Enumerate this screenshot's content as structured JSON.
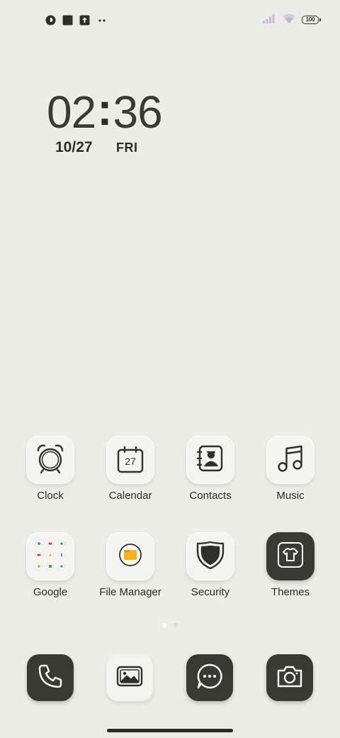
{
  "status_bar": {
    "battery_level": "100",
    "left_icons": [
      "notification-app-icon",
      "square-notification-icon",
      "upload-icon",
      "more-notifications-icon"
    ],
    "right_icons": [
      "signal-icon",
      "wifi-icon",
      "battery-icon"
    ]
  },
  "clock_widget": {
    "hours": "02",
    "separator": ":",
    "minutes": "36",
    "date": "10/27",
    "day": "FRI"
  },
  "apps": [
    {
      "label": "Clock",
      "icon": "alarm-clock-icon"
    },
    {
      "label": "Calendar",
      "icon": "calendar-icon",
      "badge": "27"
    },
    {
      "label": "Contacts",
      "icon": "contacts-book-icon"
    },
    {
      "label": "Music",
      "icon": "music-note-icon"
    },
    {
      "label": "Google",
      "icon": "google-folder-icon"
    },
    {
      "label": "File Manager",
      "icon": "folder-icon"
    },
    {
      "label": "Security",
      "icon": "shield-icon"
    },
    {
      "label": "Themes",
      "icon": "tshirt-icon"
    }
  ],
  "page_indicator": {
    "pages": 2,
    "current": 1
  },
  "dock": [
    {
      "icon": "phone-icon"
    },
    {
      "icon": "gallery-icon"
    },
    {
      "icon": "messages-icon"
    },
    {
      "icon": "camera-icon"
    }
  ],
  "colors": {
    "background": "#EDEDE8",
    "tile_light": "#F3F3EF",
    "tile_dark": "#3A3A35",
    "folder_accent": "#F5B21B",
    "text": "#2B2B28"
  }
}
